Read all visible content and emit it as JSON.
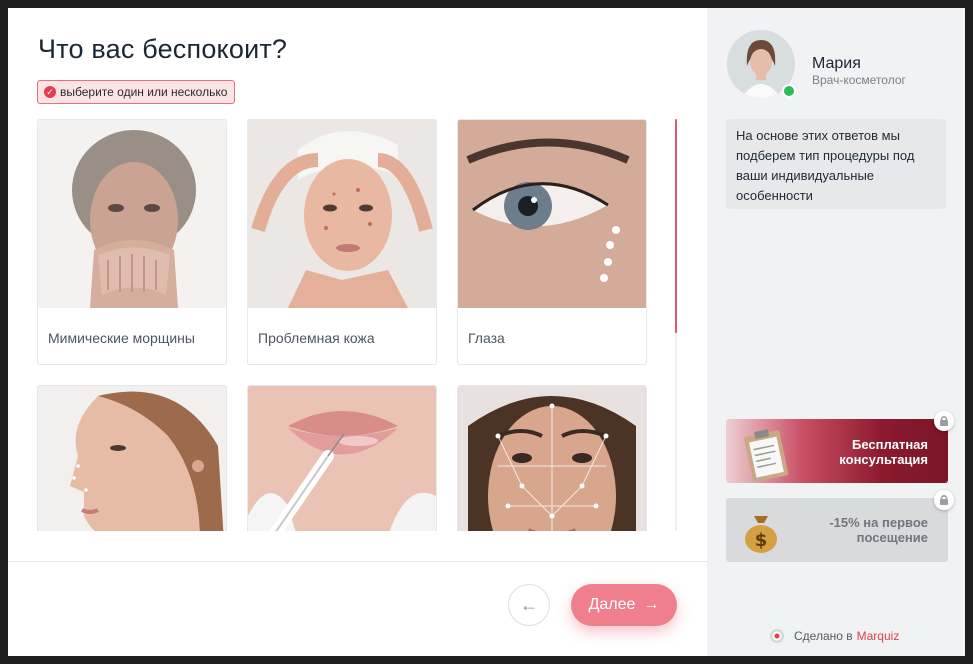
{
  "quiz": {
    "title": "Что вас беспокоит?",
    "hint": "выберите один или несколько",
    "options": [
      {
        "label": "Мимические морщины"
      },
      {
        "label": "Проблемная кожа"
      },
      {
        "label": "Глаза"
      },
      {
        "label": ""
      },
      {
        "label": ""
      },
      {
        "label": ""
      }
    ],
    "next_label": "Далее"
  },
  "consultant": {
    "name": "Мария",
    "role": "Врач-косметолог",
    "message": "На основе этих ответов мы подберем тип процедуры под ваши индивидуальные особенности"
  },
  "bonuses": [
    {
      "line1": "Бесплатная",
      "line2": "консультация"
    },
    {
      "line1": "-15% на первое",
      "line2": "посещение"
    }
  ],
  "footer": {
    "made_with": "Сделано в",
    "brand": "Marquiz"
  },
  "colors": {
    "accent": "#ef7f8c",
    "brand_red": "#e0404f",
    "online": "#2dbb57"
  }
}
